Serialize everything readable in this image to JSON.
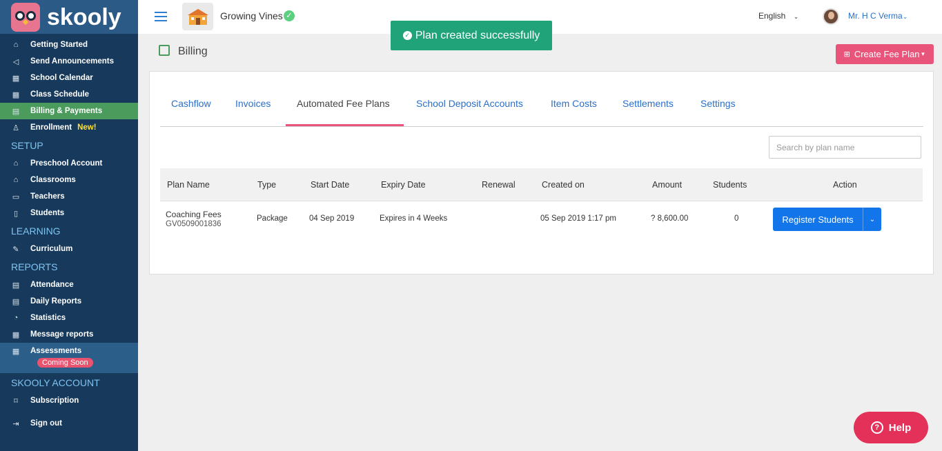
{
  "brand": {
    "name": "skooly"
  },
  "sidebar": {
    "items_top": [
      {
        "label": "Getting Started",
        "icon": "home-icon"
      },
      {
        "label": "Send Announcements",
        "icon": "megaphone-icon"
      },
      {
        "label": "School Calendar",
        "icon": "calendar-icon"
      },
      {
        "label": "Class Schedule",
        "icon": "calendar-icon"
      },
      {
        "label": "Billing & Payments",
        "icon": "billing-icon",
        "active": true
      },
      {
        "label": "Enrollment",
        "icon": "user-add-icon",
        "badge": "New!"
      }
    ],
    "setup_title": "SETUP",
    "setup_items": [
      {
        "label": "Preschool Account",
        "icon": "school-icon"
      },
      {
        "label": "Classrooms",
        "icon": "classroom-icon"
      },
      {
        "label": "Teachers",
        "icon": "teacher-icon"
      },
      {
        "label": "Students",
        "icon": "student-icon"
      }
    ],
    "learning_title": "LEARNING",
    "learning_items": [
      {
        "label": "Curriculum",
        "icon": "curriculum-icon"
      }
    ],
    "reports_title": "REPORTS",
    "reports_items": [
      {
        "label": "Attendance",
        "icon": "report-icon"
      },
      {
        "label": "Daily Reports",
        "icon": "report-icon"
      },
      {
        "label": "Statistics",
        "icon": "pie-chart-icon"
      },
      {
        "label": "Message reports",
        "icon": "message-icon"
      }
    ],
    "assessments": {
      "label": "Assessments",
      "badge": "Coming Soon"
    },
    "account_title": "SKOOLY ACCOUNT",
    "account_items": [
      {
        "label": "Subscription",
        "icon": "bookmark-icon"
      }
    ],
    "signout": "Sign out"
  },
  "topbar": {
    "school_name": "Growing Vines",
    "language": "English",
    "user_name": "Mr. H C Verma"
  },
  "toast": {
    "message": "Plan created successfully"
  },
  "page": {
    "title": "Billing",
    "create_button": "Create Fee Plan"
  },
  "tabs": [
    {
      "label": "Cashflow"
    },
    {
      "label": "Invoices"
    },
    {
      "label": "Automated Fee Plans",
      "active": true
    },
    {
      "label": "School Deposit Accounts"
    },
    {
      "label": "Item Costs"
    },
    {
      "label": "Settlements"
    },
    {
      "label": "Settings"
    }
  ],
  "search": {
    "placeholder": "Search by plan name"
  },
  "table": {
    "columns": [
      "Plan Name",
      "Type",
      "Start Date",
      "Expiry Date",
      "Renewal",
      "Created on",
      "Amount",
      "Students",
      "Action"
    ],
    "rows": [
      {
        "plan_name": "Coaching Fees",
        "plan_id": "GV0509001836",
        "type": "Package",
        "start_date": "04 Sep 2019",
        "expiry": "Expires in 4 Weeks",
        "renewal": "",
        "created_on": "05 Sep 2019 1:17 pm",
        "amount": "? 8,600.00",
        "students": "0",
        "action_label": "Register Students"
      }
    ]
  },
  "help": {
    "label": "Help"
  },
  "colors": {
    "sidebar": "#173a5c",
    "active_nav": "#4a9b5c",
    "toast": "#21a37a",
    "primary_button": "#1275ea",
    "accent_pink": "#e8547a"
  }
}
